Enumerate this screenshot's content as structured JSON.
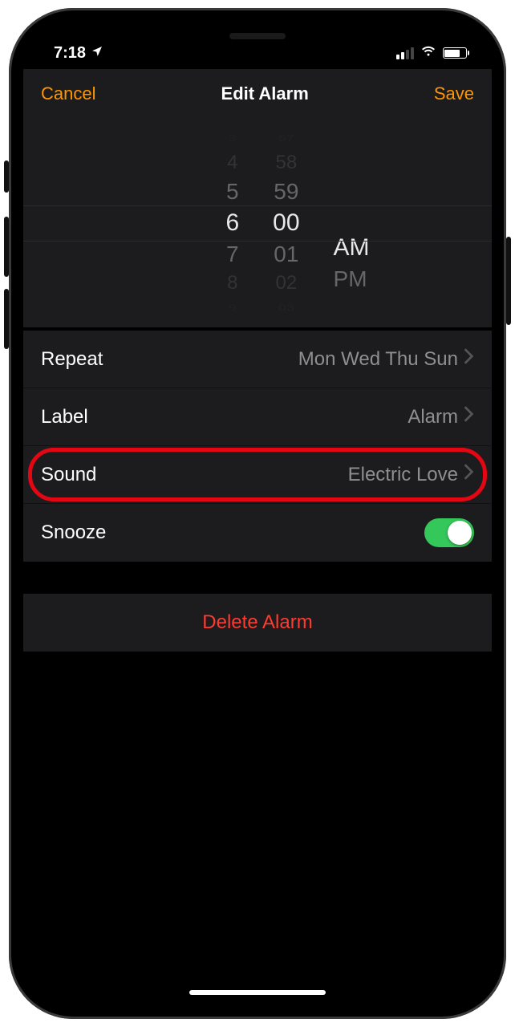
{
  "status": {
    "time": "7:18",
    "location_icon": "location-arrow",
    "cellular_bars": 2,
    "wifi": true,
    "battery_percent": 80
  },
  "nav": {
    "cancel": "Cancel",
    "title": "Edit Alarm",
    "save": "Save"
  },
  "picker": {
    "hours_above": [
      "3",
      "4",
      "5"
    ],
    "hour": "6",
    "hours_below": [
      "7",
      "8",
      "9"
    ],
    "minutes_above": [
      "57",
      "58",
      "59"
    ],
    "minute": "00",
    "minutes_below": [
      "01",
      "02",
      "03"
    ],
    "ampm_selected": "AM",
    "ampm_other": "PM"
  },
  "rows": {
    "repeat": {
      "label": "Repeat",
      "value": "Mon Wed Thu Sun"
    },
    "label": {
      "label": "Label",
      "value": "Alarm"
    },
    "sound": {
      "label": "Sound",
      "value": "Electric Love"
    },
    "snooze": {
      "label": "Snooze",
      "on": true
    }
  },
  "delete": {
    "label": "Delete Alarm"
  },
  "colors": {
    "accent": "#ff9500",
    "destructive": "#ff3b30",
    "toggle_on": "#34c759",
    "highlight": "#e30613"
  }
}
